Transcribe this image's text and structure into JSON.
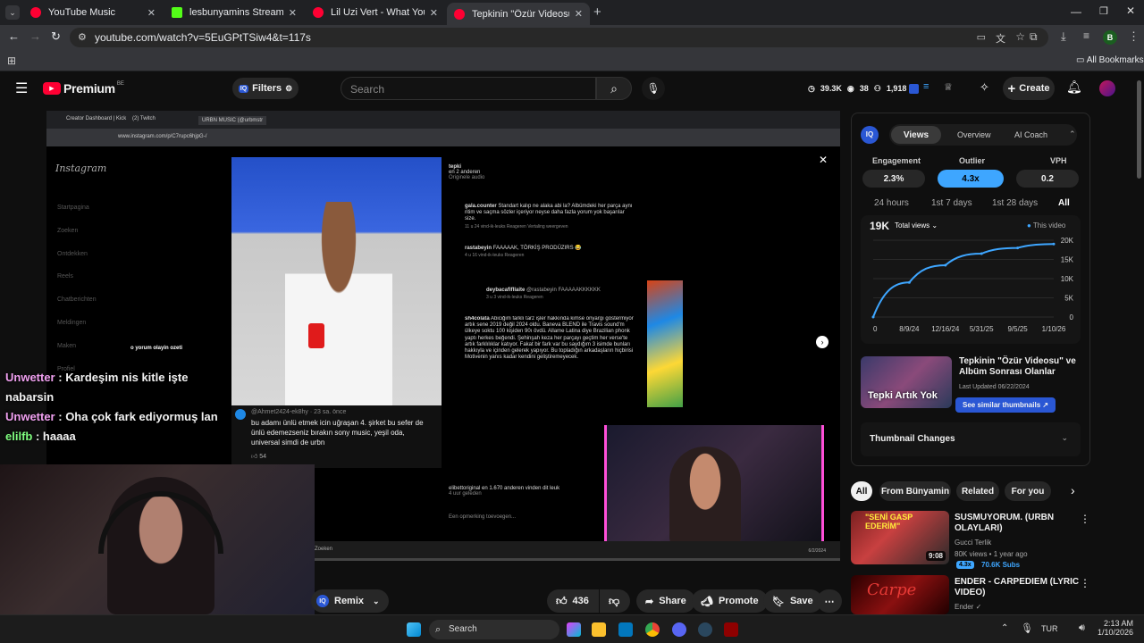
{
  "browser": {
    "tabs": [
      {
        "title": "YouTube Music",
        "color": "#ff0033"
      },
      {
        "title": "lesbunyamins Stream - Watch L",
        "color": "#53fc18"
      },
      {
        "title": "Lil Uzi Vert - What You Saying",
        "color": "#ff0033"
      },
      {
        "title": "Tepkinin \"Özür Videosu\" ve",
        "color": "#ff0033"
      }
    ],
    "url": "youtube.com/watch?v=5EuGPtTSiw4&t=117s",
    "all_bookmarks": "All Bookmarks",
    "profile_initial": "B"
  },
  "youtube": {
    "logo": "Premium",
    "logo_badge": "BE",
    "filters_label": "Filters",
    "search_placeholder": "Search",
    "stats": {
      "views": "39.3K",
      "watching": "38",
      "subs": "1,918"
    },
    "create_label": "Create"
  },
  "video_overlay": {
    "insta_logo": "Instagram",
    "url": "www.instagram.com/p/C7rupc6hjpG-/",
    "tabs": [
      "Creator Dashboard | Kick",
      "(2) Twitch",
      "URBN MUSIC (@urbmstr"
    ],
    "nav": [
      "Startpagina",
      "Zoeken",
      "Ontdekken",
      "Reels",
      "Chatberichten",
      "Meldingen",
      "Maken",
      "Profiel"
    ],
    "post_account": "tepki",
    "post_sub": "en 2 anderen",
    "post_audio": "Originele audio",
    "comments": [
      {
        "user": "gala.counter",
        "text": "Standart kalıp ne alaka abi la? Albümdeki her parça aynı ritim ve saçma sözler içeriyor neyse daha fazla yorum yok başarılar size.",
        "meta": "11 u  24 vind-ik-leuks  Reageren  Vertaling weergeven"
      },
      {
        "user": "rastabeyin",
        "text": "FAAAAAK, TÖRKİŞ PRODÜZIRS 😂",
        "meta": "4 u  16 vind-ik-leuks  Reageren"
      },
      {
        "user": "deybacafifllaite",
        "text": "@rastabeyin FAAAAAKKKKKK",
        "meta": "3 u  3 vind-ik-leuks  Reageren"
      },
      {
        "user": "sh4colata",
        "text": "Abiciğim farklı tarz işler hakkında kimse önyargı göstermiyor artık sene 2019 değil 2024 oldu. Baneva BLEND ile Travis sound'm ülkeye soktu 100 kişiden 90ı övdü. Allame Latina diye Brazilian phonk yaptı herkes beğendi. Şehinşah keza her parçayı geçtim her verse'te artık farklılıklar katıyor. Fakat bir fark var bu saydığım 3 isimde bunları hakkıyla ve içinden gelerek yapıyor. Bu topladığın arkadaşların hiçbirisi Motivenin yanıs kadar kendini geliştiremeyecek.",
        "meta": "10 u  47 vind-ik-leuks  Reageren  Vertaling weergeven"
      }
    ],
    "side_comment_user": "@Ahmet2424-ek8hy · 23 sa. önce",
    "side_comment_text": "bu adamı ünlü etmek icin uğraşan 4. şirket bu sefer de ünlü edemezseniz bırakın sony music, yeşil oda, universal simdi de urbn",
    "side_comment_likes": "54",
    "likes_line": "elibettoriginal en 1.670 anderen vinden dit leuk",
    "likes_time": "4 uur geleden",
    "add_comment": "Een opmerking toevoegen...",
    "mini_chat": "o yorum olayin ozeti",
    "taskbar_search": "Zoeken",
    "date": "6/2/2024"
  },
  "chat": [
    {
      "user": "Unwetter",
      "msg": "Kardeşim nis kitle işte nabarsin",
      "color": "#f0a0f0"
    },
    {
      "user": "Unwetter",
      "msg": "Oha çok fark ediyormuş lan",
      "color": "#f0a0f0"
    },
    {
      "user": "elilfb",
      "msg": "haaaa",
      "color": "#80ff80"
    }
  ],
  "actions": {
    "remix": "Remix",
    "likes": "436",
    "share": "Share",
    "promote": "Promote",
    "save": "Save"
  },
  "vidiq": {
    "tabs": [
      "Views",
      "Overview",
      "AI Coach"
    ],
    "active_tab": "Views",
    "metrics": [
      {
        "label": "Engagement",
        "value": "2.3%"
      },
      {
        "label": "Outlier",
        "value": "4.3x"
      },
      {
        "label": "VPH",
        "value": "0.2"
      }
    ],
    "ranges": [
      "24 hours",
      "1st 7 days",
      "1st 28 days",
      "All"
    ],
    "active_range": "All",
    "total": "19K",
    "total_label": "Total views",
    "legend": "This video",
    "accent": "#3ea6ff",
    "ad_title": "Tepkinin \"Özür Videosu\" ve Albüm Sonrası Olanlar",
    "ad_updated": "Last Updated 06/22/2024",
    "ad_thumb_text": "Tepki Artık Yok",
    "ad_button": "See similar thumbnails",
    "thumb_changes": "Thumbnail Changes"
  },
  "chart_data": {
    "type": "line",
    "x": [
      "0",
      "8/9/24",
      "12/16/24",
      "5/31/25",
      "9/5/25",
      "1/10/26"
    ],
    "series": [
      {
        "name": "This video",
        "values": [
          0,
          9000,
          13500,
          16500,
          18000,
          19000
        ]
      }
    ],
    "yticks": [
      "20K",
      "15K",
      "10K",
      "5K",
      "0"
    ],
    "ylim": [
      0,
      20000
    ]
  },
  "chips": [
    "All",
    "From Bünyamin",
    "Related",
    "For you"
  ],
  "active_chip": "All",
  "recommendations": [
    {
      "title": "SUSMUYORUM. (URBN OLAYLARI)",
      "channel": "Gucci Terlik",
      "meta": "80K views • 1 year ago",
      "duration": "9:08",
      "outlier": "4.3x",
      "subs": "70.6K Subs",
      "thumb_text": "\"SENİ GASP EDERİM\""
    },
    {
      "title": "ENDER - CARPEDIEM (LYRIC VIDEO)",
      "channel": "Ender",
      "meta": "",
      "duration": "",
      "outlier": "",
      "subs": "",
      "thumb_text": "Carpe"
    }
  ],
  "taskbar": {
    "search": "Search",
    "lang": "TUR",
    "time": "2:13 AM",
    "date": "1/10/2026"
  }
}
